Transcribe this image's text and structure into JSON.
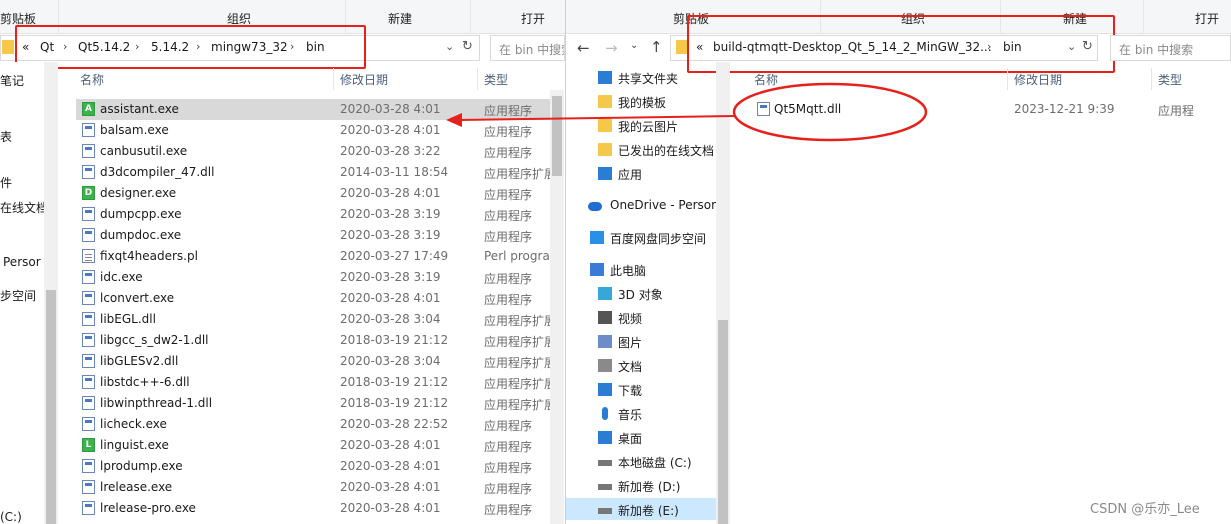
{
  "left_window": {
    "ribbon": {
      "clipboard": "剪贴板",
      "organize": "组织",
      "new": "新建",
      "open": "打开"
    },
    "address": {
      "back_glyph": "«",
      "crumbs": [
        "Qt",
        "Qt5.14.2",
        "5.14.2",
        "mingw73_32",
        "bin"
      ]
    },
    "search_placeholder": "在 bin 中搜索",
    "columns": {
      "name": "名称",
      "date": "修改日期",
      "type": "类型"
    },
    "nav_fragments": [
      "笔记",
      "表",
      "件",
      "在线文档",
      "Persor",
      "步空间",
      "(C:)"
    ],
    "files": [
      {
        "name": "assistant.exe",
        "date": "2020-03-28 4:01",
        "type": "应用程序"
      },
      {
        "name": "balsam.exe",
        "date": "2020-03-28 4:01",
        "type": "应用程序"
      },
      {
        "name": "canbusutil.exe",
        "date": "2020-03-28 3:22",
        "type": "应用程序"
      },
      {
        "name": "d3dcompiler_47.dll",
        "date": "2014-03-11 18:54",
        "type": "应用程序扩展"
      },
      {
        "name": "designer.exe",
        "date": "2020-03-28 4:01",
        "type": "应用程序"
      },
      {
        "name": "dumpcpp.exe",
        "date": "2020-03-28 3:19",
        "type": "应用程序"
      },
      {
        "name": "dumpdoc.exe",
        "date": "2020-03-28 3:19",
        "type": "应用程序"
      },
      {
        "name": "fixqt4headers.pl",
        "date": "2020-03-27 17:49",
        "type": "Perl progra"
      },
      {
        "name": "idc.exe",
        "date": "2020-03-28 3:19",
        "type": "应用程序"
      },
      {
        "name": "lconvert.exe",
        "date": "2020-03-28 4:01",
        "type": "应用程序"
      },
      {
        "name": "libEGL.dll",
        "date": "2020-03-28 3:04",
        "type": "应用程序扩展"
      },
      {
        "name": "libgcc_s_dw2-1.dll",
        "date": "2018-03-19 21:12",
        "type": "应用程序扩展"
      },
      {
        "name": "libGLESv2.dll",
        "date": "2020-03-28 3:04",
        "type": "应用程序扩展"
      },
      {
        "name": "libstdc++-6.dll",
        "date": "2018-03-19 21:12",
        "type": "应用程序扩展"
      },
      {
        "name": "libwinpthread-1.dll",
        "date": "2018-03-19 21:12",
        "type": "应用程序扩展"
      },
      {
        "name": "licheck.exe",
        "date": "2020-03-28 22:52",
        "type": "应用程序"
      },
      {
        "name": "linguist.exe",
        "date": "2020-03-28 4:01",
        "type": "应用程序"
      },
      {
        "name": "lprodump.exe",
        "date": "2020-03-28 4:01",
        "type": "应用程序"
      },
      {
        "name": "lrelease.exe",
        "date": "2020-03-28 4:01",
        "type": "应用程序"
      },
      {
        "name": "lrelease-pro.exe",
        "date": "2020-03-28 4:01",
        "type": "应用程序"
      }
    ]
  },
  "right_window": {
    "ribbon": {
      "clipboard": "剪贴板",
      "organize": "组织",
      "new": "新建",
      "open": "打开"
    },
    "address": {
      "back_glyph": "«",
      "crumbs": [
        "build-qtmqtt-Desktop_Qt_5_14_2_MinGW_32...",
        "bin"
      ]
    },
    "search_placeholder": "在 bin 中搜索",
    "columns": {
      "name": "名称",
      "date": "修改日期",
      "type": "类型"
    },
    "nav": [
      {
        "label": "共享文件夹",
        "icon": "share-icon"
      },
      {
        "label": "我的模板",
        "icon": "folder-icon"
      },
      {
        "label": "我的云图片",
        "icon": "folder-icon"
      },
      {
        "label": "已发出的在线文档",
        "icon": "folder-icon"
      },
      {
        "label": "应用",
        "icon": "apps-icon"
      },
      {
        "label": "OneDrive - Persor",
        "icon": "cloud-icon"
      },
      {
        "label": "百度网盘同步空间",
        "icon": "baidu-icon"
      },
      {
        "label": "此电脑",
        "icon": "pc-icon"
      },
      {
        "label": "3D 对象",
        "icon": "cube-icon"
      },
      {
        "label": "视频",
        "icon": "video-icon"
      },
      {
        "label": "图片",
        "icon": "picture-icon"
      },
      {
        "label": "文档",
        "icon": "document-icon"
      },
      {
        "label": "下载",
        "icon": "download-icon"
      },
      {
        "label": "音乐",
        "icon": "music-icon"
      },
      {
        "label": "桌面",
        "icon": "desktop-icon"
      },
      {
        "label": "本地磁盘 (C:)",
        "icon": "drive-icon"
      },
      {
        "label": "新加卷 (D:)",
        "icon": "drive-icon"
      },
      {
        "label": "新加卷 (E:)",
        "icon": "drive-icon"
      }
    ],
    "files": [
      {
        "name": "Qt5Mqtt.dll",
        "date": "2023-12-21 9:39",
        "type": "应用程"
      }
    ]
  },
  "watermark": "CSDN @乐亦_Lee",
  "colors": {
    "annotation_red": "#e8201c",
    "selected_row": "#d9d9d9"
  }
}
